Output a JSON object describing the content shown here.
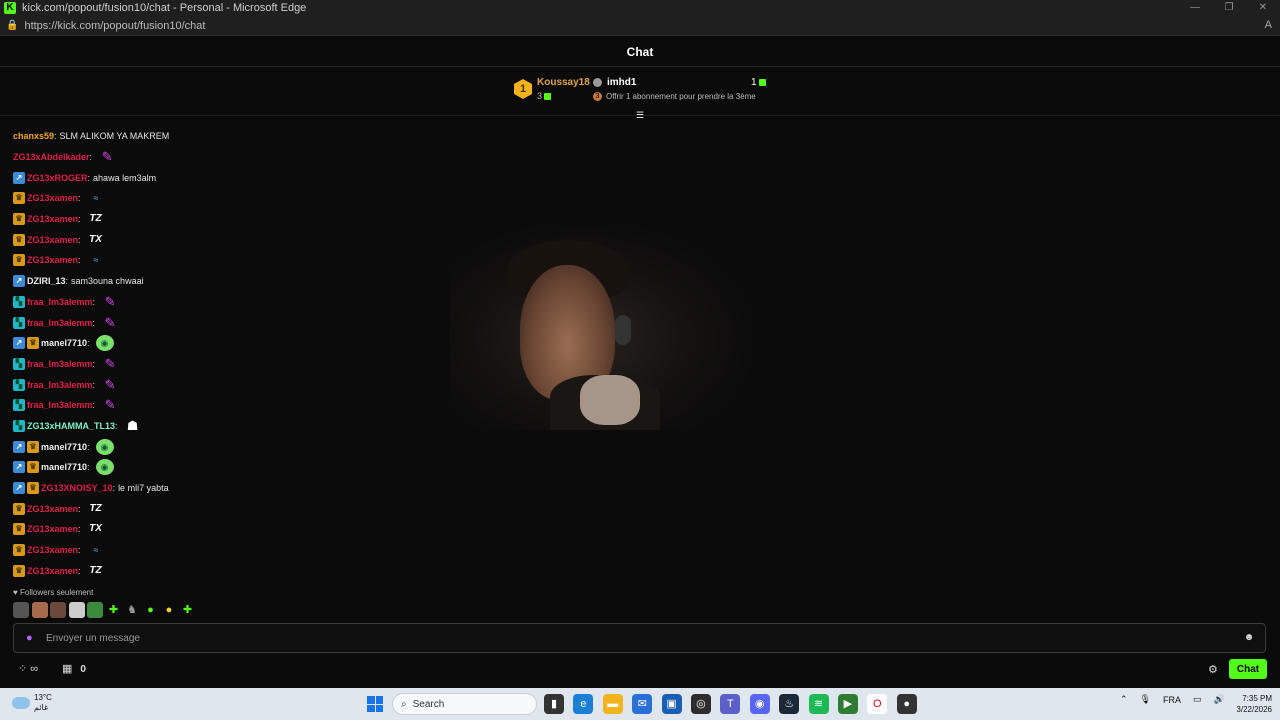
{
  "window": {
    "title": "kick.com/popout/fusion10/chat - Personal - Microsoft Edge",
    "url": "https://kick.com/popout/fusion10/chat"
  },
  "chat": {
    "header_title": "Chat",
    "leaderboard": {
      "first": {
        "rank": "1",
        "name": "Koussay18",
        "count": "3"
      },
      "second": {
        "name": "imhd1",
        "count": "1"
      },
      "offer_text": "Offrir 1 abonnement pour prendre la 3ème",
      "offer_rank": "3"
    },
    "messages": [
      {
        "badges": [],
        "user": "chanxs59",
        "color": "c-orange",
        "text": "SLM ALIKOM YA MAKREM",
        "emote": ""
      },
      {
        "badges": [],
        "user": "ZG13xAbdelkader",
        "color": "c-red",
        "text": "",
        "emote": "feather"
      },
      {
        "badges": [
          "arrow"
        ],
        "user": "ZG13xROGER",
        "color": "c-red",
        "text": "ahawa lem3alm",
        "emote": ""
      },
      {
        "badges": [
          "crown"
        ],
        "user": "ZG13xamen",
        "color": "c-red",
        "text": "",
        "emote": "wave"
      },
      {
        "badges": [
          "crown"
        ],
        "user": "ZG13xamen",
        "color": "c-red",
        "text": "",
        "emote": "tz"
      },
      {
        "badges": [
          "crown"
        ],
        "user": "ZG13xamen",
        "color": "c-red",
        "text": "",
        "emote": "tx"
      },
      {
        "badges": [
          "crown"
        ],
        "user": "ZG13xamen",
        "color": "c-red",
        "text": "",
        "emote": "wave"
      },
      {
        "badges": [
          "arrow"
        ],
        "user": "DZIRI_13",
        "color": "c-white",
        "text": "sam3ouna chwaai",
        "emote": ""
      },
      {
        "badges": [
          "sub"
        ],
        "user": "fraa_lm3alemm",
        "color": "c-red",
        "text": "",
        "emote": "feather"
      },
      {
        "badges": [
          "sub"
        ],
        "user": "fraa_lm3alemm",
        "color": "c-red",
        "text": "",
        "emote": "feather"
      },
      {
        "badges": [
          "arrow",
          "crown"
        ],
        "user": "manel7710",
        "color": "c-white",
        "text": "",
        "emote": "blob"
      },
      {
        "badges": [
          "sub"
        ],
        "user": "fraa_lm3alemm",
        "color": "c-red",
        "text": "",
        "emote": "feather"
      },
      {
        "badges": [
          "sub"
        ],
        "user": "fraa_lm3alemm",
        "color": "c-red",
        "text": "",
        "emote": "feather"
      },
      {
        "badges": [
          "sub"
        ],
        "user": "fraa_lm3alemm",
        "color": "c-red",
        "text": "",
        "emote": "feather"
      },
      {
        "badges": [
          "sub"
        ],
        "user": "ZG13xHAMMA_TL13",
        "color": "c-mint",
        "text": "",
        "emote": "ghost"
      },
      {
        "badges": [
          "arrow",
          "crown"
        ],
        "user": "manel7710",
        "color": "c-white",
        "text": "",
        "emote": "blob"
      },
      {
        "badges": [
          "arrow",
          "crown"
        ],
        "user": "manel7710",
        "color": "c-white",
        "text": "",
        "emote": "blob"
      },
      {
        "badges": [
          "arrow",
          "crown"
        ],
        "user": "ZG13XNOISY_10",
        "color": "c-red",
        "text": "le mli7 yabta",
        "emote": ""
      },
      {
        "badges": [
          "crown"
        ],
        "user": "ZG13xamen",
        "color": "c-red",
        "text": "",
        "emote": "tz"
      },
      {
        "badges": [
          "crown"
        ],
        "user": "ZG13xamen",
        "color": "c-red",
        "text": "",
        "emote": "tx"
      },
      {
        "badges": [
          "crown"
        ],
        "user": "ZG13xamen",
        "color": "c-red",
        "text": "",
        "emote": "wave"
      },
      {
        "badges": [
          "crown"
        ],
        "user": "ZG13xamen",
        "color": "c-red",
        "text": "",
        "emote": "tz"
      }
    ],
    "followers_mode": "Followers seulement",
    "input_placeholder": "Envoyer un message",
    "points_label": "∞",
    "gift_count": "0",
    "send_label": "Chat",
    "accent_color": "#53fc18"
  },
  "taskbar": {
    "weather_temp": "13°C",
    "weather_sub": "غائم",
    "search_label": "Search",
    "language": "FRA",
    "time": "7:35 PM",
    "date": "3/22/2026"
  }
}
